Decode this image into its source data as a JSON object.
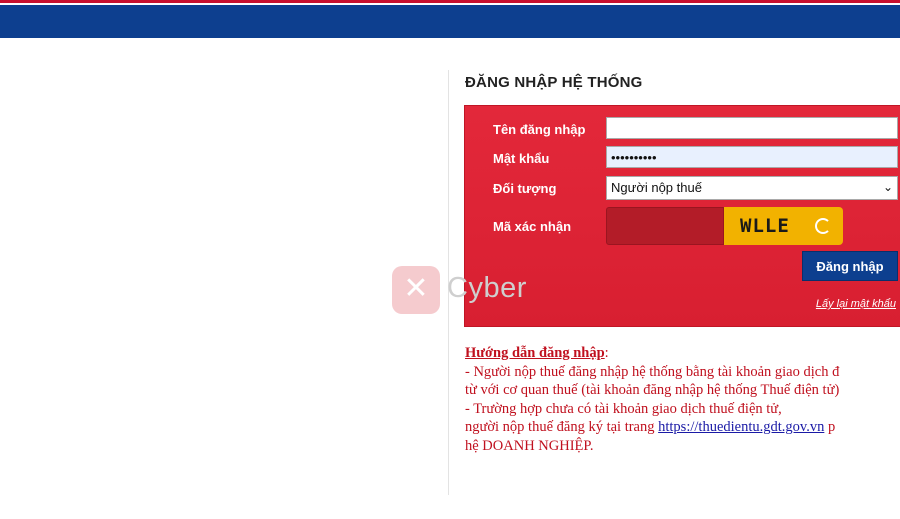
{
  "login": {
    "title": "ĐĂNG NHẬP HỆ THỐNG",
    "username_label": "Tên đăng nhập",
    "username_value": "",
    "password_label": "Mật khẩu",
    "password_value": "••••••••••",
    "role_label": "Đối tượng",
    "role_selected": "Người nộp thuế",
    "captcha_label": "Mã xác nhận",
    "captcha_value": "",
    "captcha_text": "WLLE",
    "submit_label": "Đăng nhập",
    "forgot_link": "Lấy lại mật khẩu"
  },
  "guide": {
    "title": "Hướng dẫn đăng nhập",
    "title_suffix": ":",
    "line1": "- Người nộp thuế đăng nhập hệ thống bằng tài khoản giao dịch đ",
    "line2": "từ với cơ quan thuế (tài khoản đăng nhập hệ thống Thuế điện tử)",
    "line3": "- Trường hợp chưa có tài khoản giao dịch thuế điện tử,",
    "line4_prefix": "người nộp thuế đăng ký tại trang ",
    "link": "https://thuedientu.gdt.gov.vn",
    "line4_suffix": " p",
    "line5": "hệ DOANH NGHIỆP."
  },
  "watermark": {
    "text": "Cyber"
  },
  "colors": {
    "header_blue": "#0d3f8f",
    "panel_red": "#e3283a",
    "captcha_yellow": "#f2b200",
    "button_blue": "#0d3f8f"
  }
}
